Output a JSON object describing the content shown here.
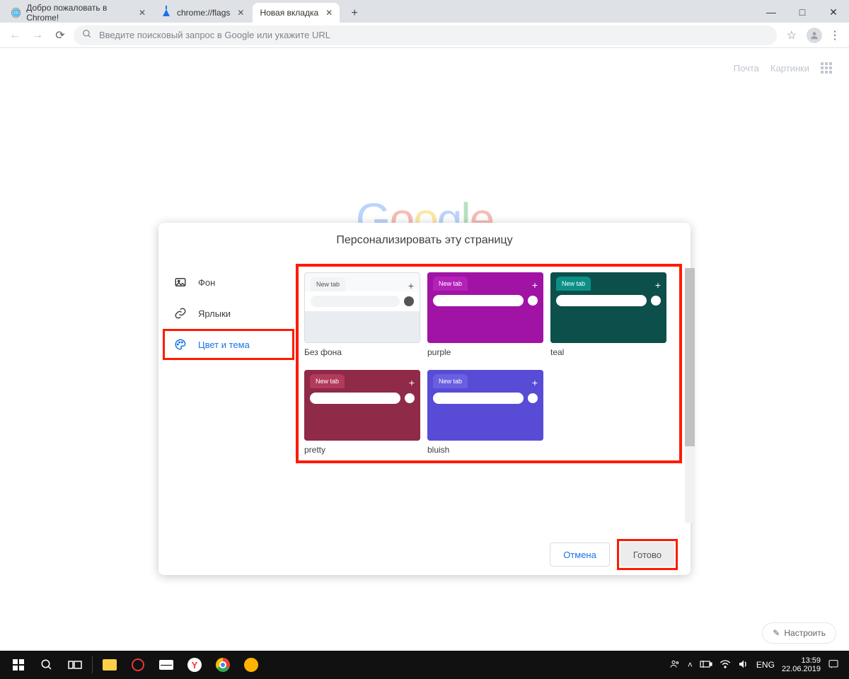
{
  "window": {
    "tabs": [
      {
        "title": "Добро пожаловать в Chrome!"
      },
      {
        "title": "chrome://flags"
      },
      {
        "title": "Новая вкладка"
      }
    ],
    "controls": {
      "min": "—",
      "max": "□",
      "close": "✕"
    }
  },
  "toolbar": {
    "omnibox_placeholder": "Введите поисковый запрос в Google или укажите URL"
  },
  "ntp": {
    "links": {
      "mail": "Почта",
      "images": "Картинки"
    },
    "customize": "Настроить"
  },
  "dialog": {
    "title": "Персонализировать эту страницу",
    "sidebar": {
      "background": "Фон",
      "shortcuts": "Ярлыки",
      "color": "Цвет и тема"
    },
    "themes": [
      {
        "label": "Без фона",
        "tab_label": "New tab",
        "tab_bg": "#f1f3f4",
        "tab_fg": "#555",
        "bar_bg": "#ffffff",
        "omni_bg": "#f1f3f4",
        "body_bg": "#e9edf1",
        "plus_fg": "#555",
        "avatar_bg": "#555"
      },
      {
        "label": "purple",
        "tab_label": "New tab",
        "tab_bg": "#b321b8",
        "tab_fg": "#ffffff",
        "bar_bg": "#a013a5",
        "omni_bg": "#ffffff",
        "body_bg": "#a013a5",
        "plus_fg": "#ffffff",
        "avatar_bg": "#ffffff"
      },
      {
        "label": "teal",
        "tab_label": "New tab",
        "tab_bg": "#0b9086",
        "tab_fg": "#ffffff",
        "bar_bg": "#0d4f4a",
        "omni_bg": "#ffffff",
        "body_bg": "#0d4f4a",
        "plus_fg": "#ffffff",
        "avatar_bg": "#ffffff"
      },
      {
        "label": "pretty",
        "tab_label": "New tab",
        "tab_bg": "#b23a5b",
        "tab_fg": "#ffffff",
        "bar_bg": "#8f2a48",
        "omni_bg": "#ffffff",
        "body_bg": "#8f2a48",
        "plus_fg": "#ffffff",
        "avatar_bg": "#ffffff"
      },
      {
        "label": "bluish",
        "tab_label": "New tab",
        "tab_bg": "#6a5fe0",
        "tab_fg": "#ffffff",
        "bar_bg": "#584bd6",
        "omni_bg": "#ffffff",
        "body_bg": "#584bd6",
        "plus_fg": "#ffffff",
        "avatar_bg": "#ffffff"
      }
    ],
    "footer": {
      "cancel": "Отмена",
      "done": "Готово"
    }
  },
  "taskbar": {
    "lang": "ENG",
    "time": "13:59",
    "date": "22.06.2019"
  }
}
